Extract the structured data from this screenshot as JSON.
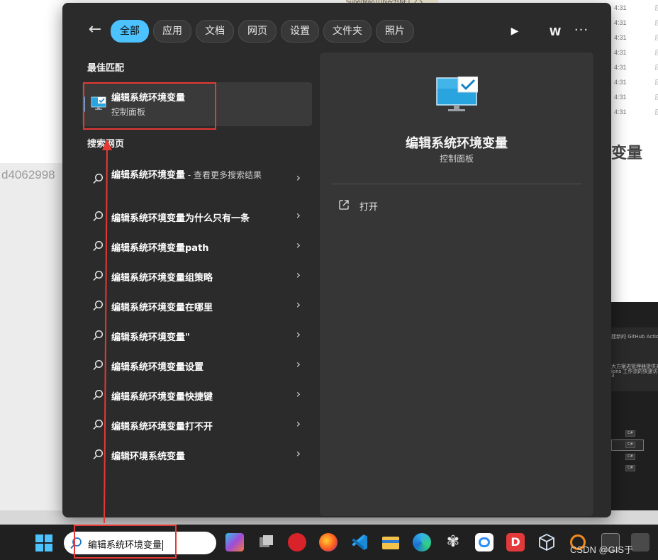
{
  "background": {
    "left_partial_text": "d4062998",
    "right_partial_title": "变量",
    "right_times": [
      "4:31",
      "4:31",
      "4:31",
      "4:31",
      "4:31",
      "4:31",
      "4:31",
      "4:31"
    ],
    "right_col_char": "应",
    "file_snippet": "SuperMapTObjectsNET_2.5…",
    "dark_text_lines": [
      "建新的 GitHub Actions 工",
      "大方案进管理器提供对另",
      "ions 工作流的快速访问和创建",
      "3"
    ],
    "chip_label": "C#"
  },
  "filters": [
    {
      "label": "全部",
      "active": true
    },
    {
      "label": "应用",
      "active": false
    },
    {
      "label": "文档",
      "active": false
    },
    {
      "label": "网页",
      "active": false
    },
    {
      "label": "设置",
      "active": false
    },
    {
      "label": "文件夹",
      "active": false
    },
    {
      "label": "照片",
      "active": false
    }
  ],
  "header": {
    "back_glyph": "←",
    "play_glyph": "▶",
    "user_initial": "W",
    "more_glyph": "···"
  },
  "best_match": {
    "section_label": "最佳匹配",
    "title": "编辑系统环境变量",
    "subtitle": "控制面板"
  },
  "web_search": {
    "section_label": "搜索网页",
    "results": [
      {
        "text": "编辑系统环境变量",
        "suffix": " - 查看更多搜索结果"
      },
      {
        "text": "编辑系统环境变量为什么只有一条",
        "suffix": ""
      },
      {
        "text": "编辑系统环境变量path",
        "suffix": ""
      },
      {
        "text": "编辑系统环境变量组策略",
        "suffix": ""
      },
      {
        "text": "编辑系统环境变量在哪里",
        "suffix": ""
      },
      {
        "text": "编辑系统环境变量\"",
        "suffix": ""
      },
      {
        "text": "编辑系统环境变量设置",
        "suffix": ""
      },
      {
        "text": "编辑系统环境变量快捷键",
        "suffix": ""
      },
      {
        "text": "编辑系统环境变量打不开",
        "suffix": ""
      },
      {
        "text": "编辑环境系统变量",
        "suffix": ""
      }
    ],
    "chevron": "›"
  },
  "detail": {
    "title": "编辑系统环境变量",
    "subtitle": "控制面板",
    "open_label": "打开"
  },
  "taskbar": {
    "search_text": "编辑系统环境变量",
    "apps": [
      "copilot-pre",
      "task-view",
      "netease-music",
      "firefox",
      "vscode",
      "file-explorer",
      "edge",
      "app-pinwheel",
      "baidu-netdisk",
      "app-d-red",
      "cube-app",
      "app-orange",
      "terminal",
      "monitor-app"
    ],
    "watermark": "CSDN @GIS于"
  },
  "colors": {
    "accent": "#4cc2ff",
    "panel": "#2b2b2b",
    "detail_pane": "#363636",
    "annotation_red": "#e53935"
  }
}
